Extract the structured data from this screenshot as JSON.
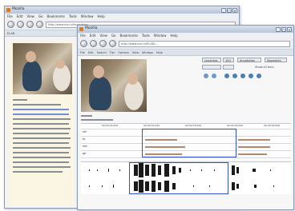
{
  "back_window": {
    "title": "Mozilla",
    "menu": [
      "File",
      "Edit",
      "View",
      "Go",
      "Bookmarks",
      "Tools",
      "Window",
      "Help"
    ],
    "address": "http://www.mpi.nl/tools/elan/...",
    "tab": "ELAN"
  },
  "front_window": {
    "title": "Mozilla",
    "menu": [
      "File",
      "Edit",
      "View",
      "Go",
      "Bookmarks",
      "Tools",
      "Window",
      "Help"
    ],
    "address": "http://www.mpi.nl/ELAN/...",
    "tabs": [
      "File",
      "Edit",
      "Search",
      "Tier",
      "Options",
      "View",
      "Window",
      "Help"
    ],
    "controls": {
      "zoom_select": "Loudness",
      "zoom_value": "100",
      "annotation_btn": "Annotation",
      "segment_btn": "Segments"
    },
    "tiers": [
      "ref",
      "tx",
      "mb",
      "ge"
    ],
    "check_label": "Show all tiers",
    "time_ruler": [
      "00:00:01.000",
      "00:00:02.000",
      "00:00:03.000",
      "00:00:04.000",
      "00:00:05.000"
    ]
  },
  "colors": {
    "selection": "#3550c8",
    "highlight": "#6f8fd8",
    "red_marker": "#d04040"
  }
}
